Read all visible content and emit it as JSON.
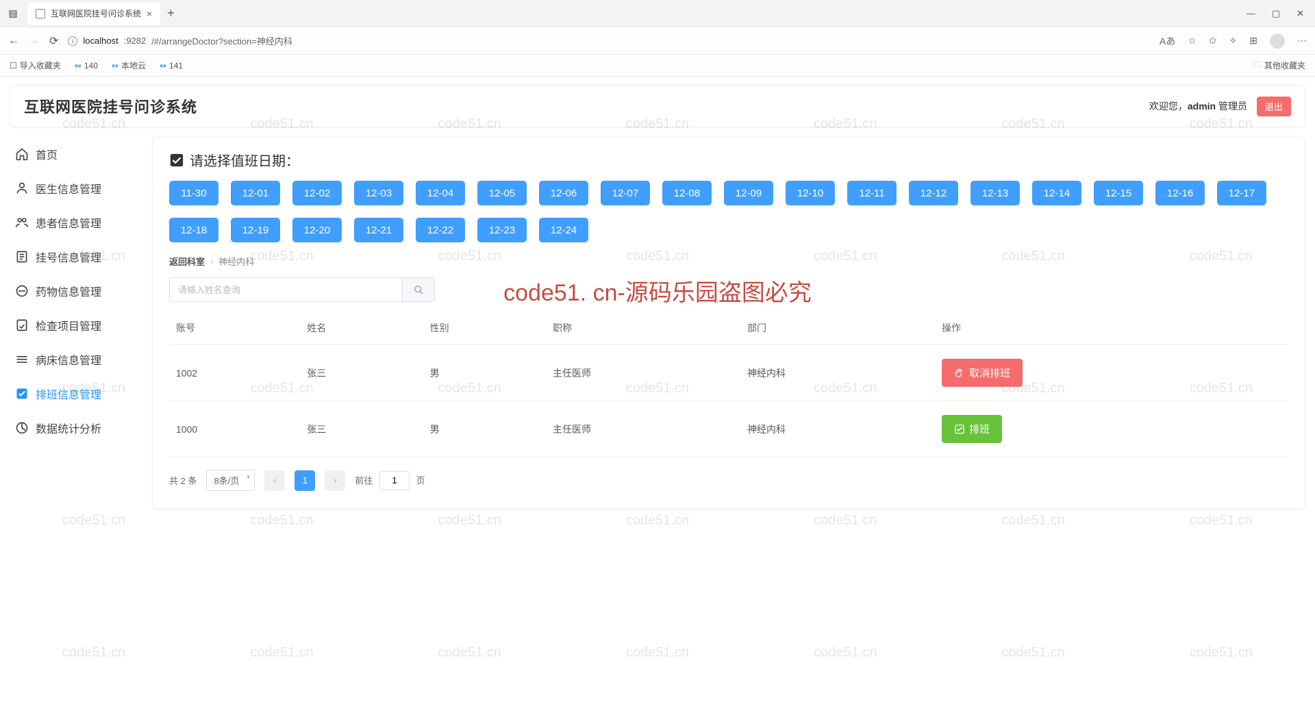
{
  "browser": {
    "tab_title": "互联网医院挂号问诊系统",
    "url_host": "localhost",
    "url_port": ":9282",
    "url_path": "/#/arrangeDoctor?section=神经内科",
    "bookmarks": {
      "import": "导入收藏夹",
      "b1": "140",
      "b2": "本地云",
      "b3": "141",
      "other": "其他收藏夹"
    }
  },
  "header": {
    "title": "互联网医院挂号问诊系统",
    "welcome_prefix": "欢迎您，",
    "username": "admin",
    "role": " 管理员",
    "logout": "退出"
  },
  "sidebar": {
    "items": [
      {
        "label": "首页",
        "icon": "home"
      },
      {
        "label": "医生信息管理",
        "icon": "doctor"
      },
      {
        "label": "患者信息管理",
        "icon": "patients"
      },
      {
        "label": "挂号信息管理",
        "icon": "register"
      },
      {
        "label": "药物信息管理",
        "icon": "medicine"
      },
      {
        "label": "检查项目管理",
        "icon": "checkup"
      },
      {
        "label": "病床信息管理",
        "icon": "bed"
      },
      {
        "label": "排班信息管理",
        "icon": "schedule",
        "active": true
      },
      {
        "label": "数据统计分析",
        "icon": "stats"
      }
    ]
  },
  "main": {
    "date_section_title": "请选择值班日期：",
    "dates": [
      "11-30",
      "12-01",
      "12-02",
      "12-03",
      "12-04",
      "12-05",
      "12-06",
      "12-07",
      "12-08",
      "12-09",
      "12-10",
      "12-11",
      "12-12",
      "12-13",
      "12-14",
      "12-15",
      "12-16",
      "12-17",
      "12-18",
      "12-19",
      "12-20",
      "12-21",
      "12-22",
      "12-23",
      "12-24"
    ],
    "breadcrumb": {
      "back": "返回科室",
      "current": "神经内科"
    },
    "search_placeholder": "请输入姓名查询",
    "columns": [
      "账号",
      "姓名",
      "性别",
      "职称",
      "部门",
      "操作"
    ],
    "rows": [
      {
        "acct": "1002",
        "name": "张三",
        "gender": "男",
        "title": "主任医师",
        "dept": "神经内科",
        "op": "cancel",
        "op_label": "取消排班"
      },
      {
        "acct": "1000",
        "name": "张三",
        "gender": "男",
        "title": "主任医师",
        "dept": "神经内科",
        "op": "assign",
        "op_label": "排班"
      }
    ],
    "pager": {
      "total_text": "共 2 条",
      "size": "8条/页",
      "current": "1",
      "goto_prefix": "前往",
      "goto_suffix": "页",
      "goto_value": "1"
    }
  },
  "watermark": {
    "cell": "code51.cn",
    "big": "code51. cn-源码乐园盗图必究"
  }
}
